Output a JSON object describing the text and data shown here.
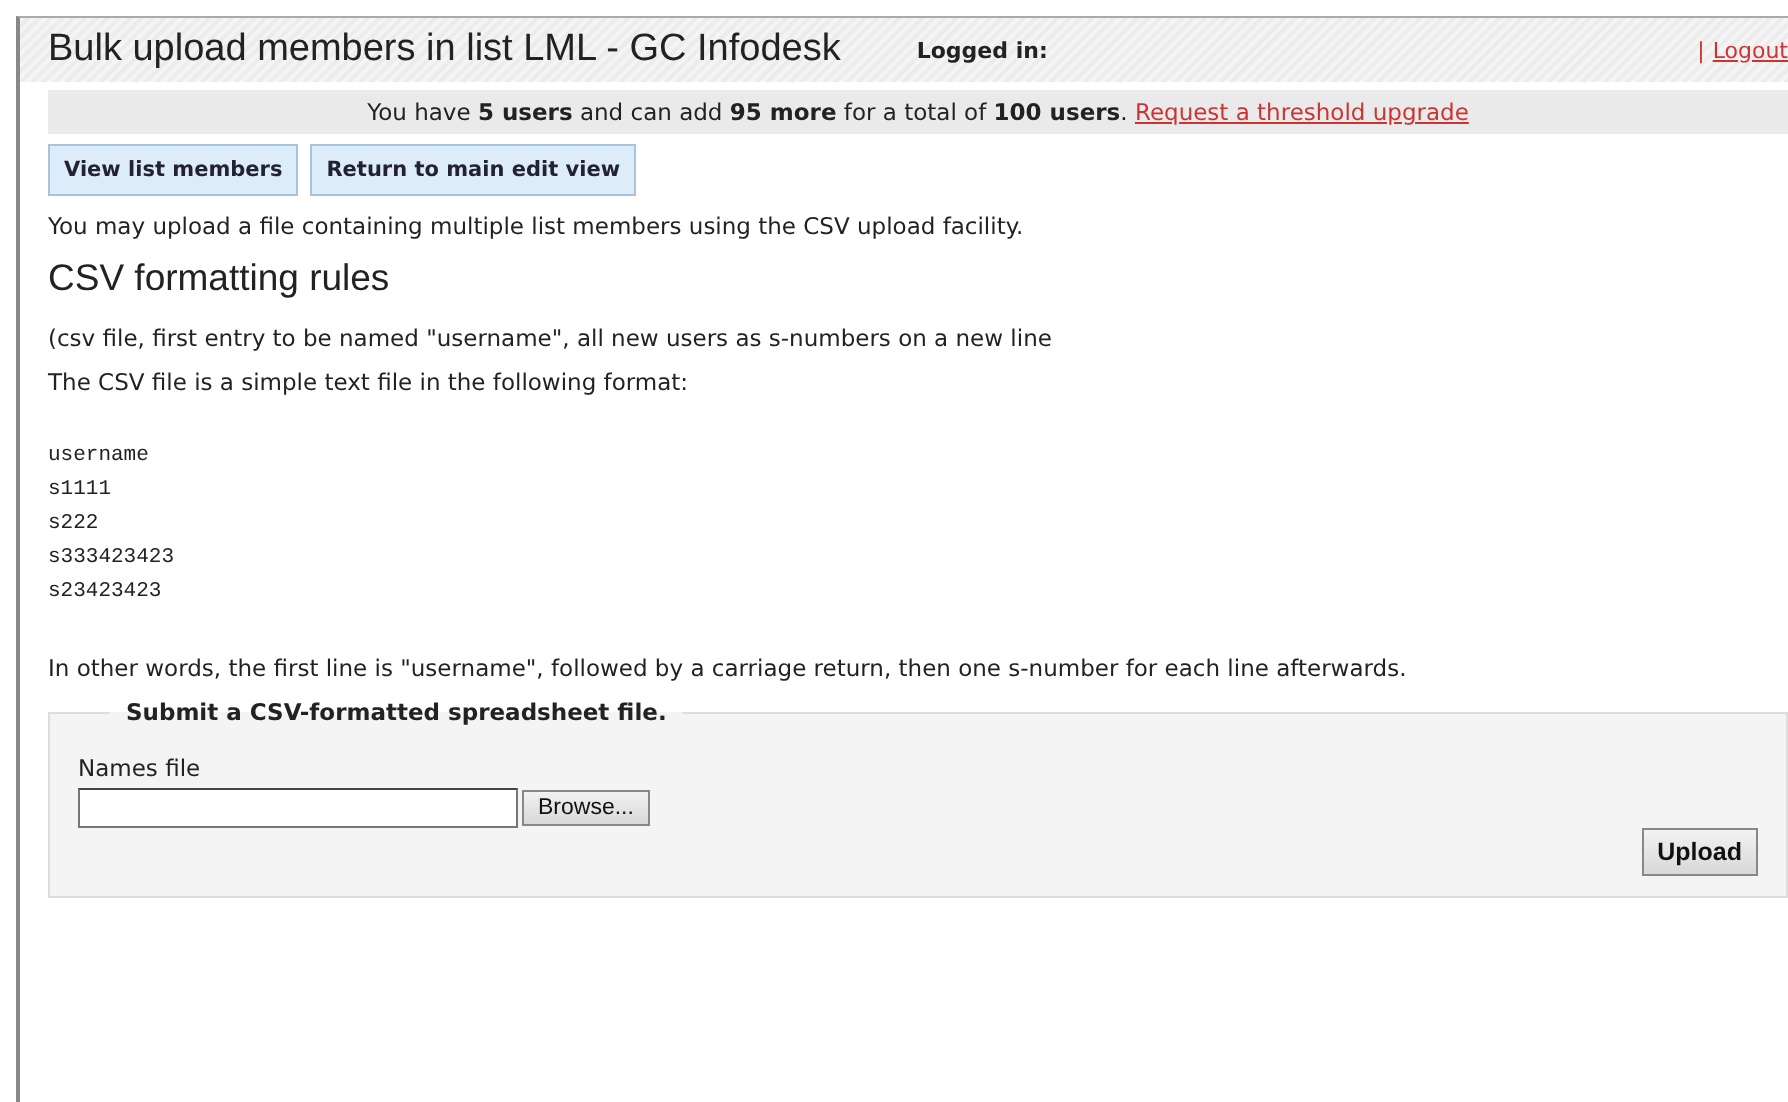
{
  "header": {
    "title": "Bulk upload members in list LML - GC Infodesk",
    "logged_in_label": "Logged in:",
    "separator": "|",
    "logout_link": "Logout"
  },
  "notice": {
    "text": "You have **5 users** and can add **95 more** for a total of **100 users**.",
    "link": "Request a threshold upgrade"
  },
  "buttons": [
    "View list members",
    "Return to main edit view"
  ],
  "intro": "You may upload a file containing multiple list members using the CSV upload facility.",
  "section_heading": "CSV formatting rules",
  "rule_note": "(csv file, first entry to be named \"username\", all new users as s-numbers on a new line",
  "format_intro": "The CSV file is a simple text file in the following format:",
  "example_lines": [
    "username",
    "s1111",
    "s222",
    "s333423423",
    "s23423423"
  ],
  "explanation": "In other words, the first line is \"username\", followed by a carriage return, then one s-number for each line afterwards.",
  "form": {
    "legend": "Submit a CSV-formatted spreadsheet file.",
    "field_label": "Names file",
    "browse_button": "Browse...",
    "submit_button": "Upload"
  }
}
